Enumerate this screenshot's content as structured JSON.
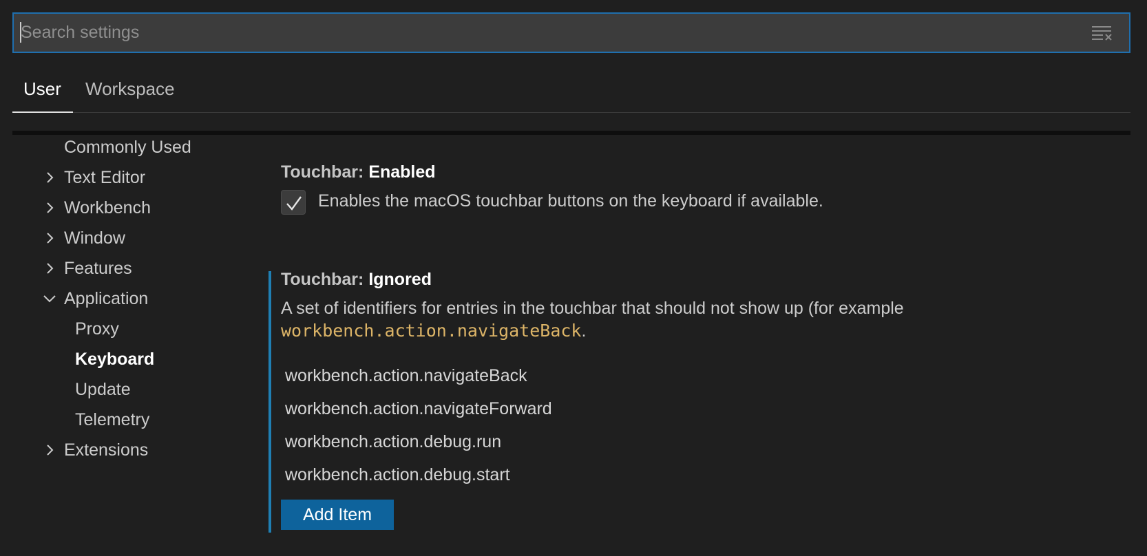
{
  "search": {
    "placeholder": "Search settings",
    "value": "",
    "clear_icon": "clear-filter-icon"
  },
  "tabs": [
    {
      "label": "User",
      "active": true
    },
    {
      "label": "Workspace",
      "active": false
    }
  ],
  "toc": {
    "items": [
      {
        "label": "Commonly Used",
        "chevron": "none"
      },
      {
        "label": "Text Editor",
        "chevron": "right"
      },
      {
        "label": "Workbench",
        "chevron": "right"
      },
      {
        "label": "Window",
        "chevron": "right"
      },
      {
        "label": "Features",
        "chevron": "right"
      },
      {
        "label": "Application",
        "chevron": "down"
      },
      {
        "label": "Proxy",
        "chevron": "none"
      },
      {
        "label": "Keyboard",
        "chevron": "none",
        "selected": true
      },
      {
        "label": "Update",
        "chevron": "none"
      },
      {
        "label": "Telemetry",
        "chevron": "none"
      },
      {
        "label": "Extensions",
        "chevron": "right"
      }
    ]
  },
  "settings": {
    "touchbar_enabled": {
      "category": "Touchbar: ",
      "name": "Enabled",
      "checked": true,
      "description": "Enables the macOS touchbar buttons on the keyboard if available."
    },
    "touchbar_ignored": {
      "category": "Touchbar: ",
      "name": "Ignored",
      "description": "A set of identifiers for entries in the touchbar that should not show up (for example",
      "code_example": "workbench.action.navigateBack",
      "code_suffix": ".",
      "items": [
        "workbench.action.navigateBack",
        "workbench.action.navigateForward",
        "workbench.action.debug.run",
        "workbench.action.debug.start"
      ],
      "add_button_label": "Add Item"
    }
  },
  "colors": {
    "background": "#1f1f1f",
    "accent": "#1f7fb3",
    "button": "#0e639c",
    "code": "#dcb467"
  }
}
